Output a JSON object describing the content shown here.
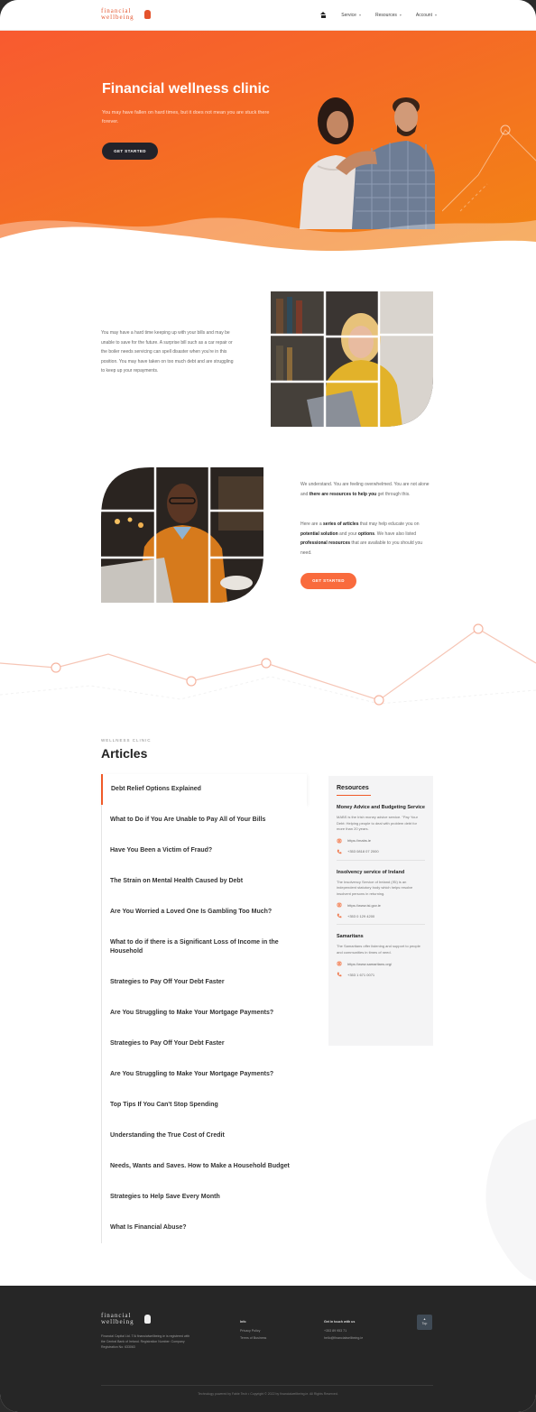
{
  "header": {
    "logo_line1": "financial",
    "logo_line2": "wellbeing",
    "nav": [
      {
        "label": "Service"
      },
      {
        "label": "Resources"
      },
      {
        "label": "Account"
      }
    ]
  },
  "hero": {
    "title": "Financial wellness clinic",
    "text": "You may have fallen on hard times, but it does not mean you are stuck there forever.",
    "button": "GET STARTED"
  },
  "intro1": {
    "text": "You may have a hard time keeping up with your bills and may be unable to save for the future. A surprise bill such as a car repair or the boiler needs servicing can spell disaster when you're in this position. You may have taken on too much debt and are struggling to keep up your repayments."
  },
  "intro2": {
    "p1a": "We understand. You are feeling overwhelmed. You are not alone and ",
    "p1b": "there are resources to help you",
    "p1c": " get through this.",
    "p2a": "Here are a ",
    "p2b": "series of articles",
    "p2c": " that may help educate you on ",
    "p2d": "potential solution",
    "p2e": " and your ",
    "p2f": "options",
    "p2g": ". We have also listed ",
    "p2h": "professional resources",
    "p2i": " that are available to you should you need.",
    "button": "GET STARTED"
  },
  "articles": {
    "eyebrow": "WELLNESS CLINIC",
    "title": "Articles",
    "items": [
      "Debt Relief Options Explained",
      "What to Do if You Are Unable to Pay All of Your Bills",
      "Have You Been a Victim of Fraud?",
      "The Strain on Mental Health Caused by Debt",
      "Are You Worried a Loved One Is Gambling Too Much?",
      "What to do if there is a Significant Loss of Income in the Household",
      "Strategies to Pay Off Your Debt Faster",
      "Are You Struggling to Make Your Mortgage Payments?",
      "Strategies to Pay Off Your Debt Faster",
      "Are You Struggling to Make Your Mortgage Payments?",
      "Top Tips If You Can't Stop Spending",
      "Understanding the True Cost of Credit",
      "Needs, Wants and Saves. How to Make a Household Budget",
      "Strategies to Help Save Every Month",
      "What Is Financial Abuse?"
    ]
  },
  "resources": {
    "title": "Resources",
    "orgs": [
      {
        "name": "Money Advice and Budgeting Service",
        "desc": "MABS is the Irish money advice service. \"Pay Your Debt: Helping people to deal with problem debt for more than 20 years.",
        "url": "https://mabs.ie",
        "phone": "+353 0818 07 2000"
      },
      {
        "name": "Insolvency service of Ireland",
        "desc": "The Insolvency Service of Ireland (ISI) is an independent statutory body which helps resolve insolvent persons in returning.",
        "url": "https://www.isi.gov.ie",
        "phone": "+353 0 129 4200"
      },
      {
        "name": "Samaritans",
        "desc": "The Samaritans offer listening and support to people and communities in times of need.",
        "url": "https://www.samaritans.org/",
        "phone": "+353 1 671 0071"
      }
    ]
  },
  "footer": {
    "logo_line1": "financial",
    "logo_line2": "wellbeing",
    "about": "Financial Capital Ltd. T/A financialwellbeing.ie is registered with the Central Bank of Ireland. Registration Number: Company Registration No: 633063",
    "col1_head": "Info",
    "col1_links": [
      "Privacy Policy",
      "Terms of Business"
    ],
    "col2_head": "Get in touch with us",
    "col2_lines": [
      "+353 89 953 71",
      "hello@financialwellbeing.ie"
    ],
    "top_label": "Top",
    "copyright": "Technology powered by Fable Tech • Copyright © 2022 by financialwellbeing.ie. All Rights Reserved."
  },
  "colors": {
    "accent": "#f05a28",
    "hero_start": "#f85a30",
    "hero_end": "#f28613",
    "dark": "#23232a",
    "footer_bg": "#262626"
  }
}
